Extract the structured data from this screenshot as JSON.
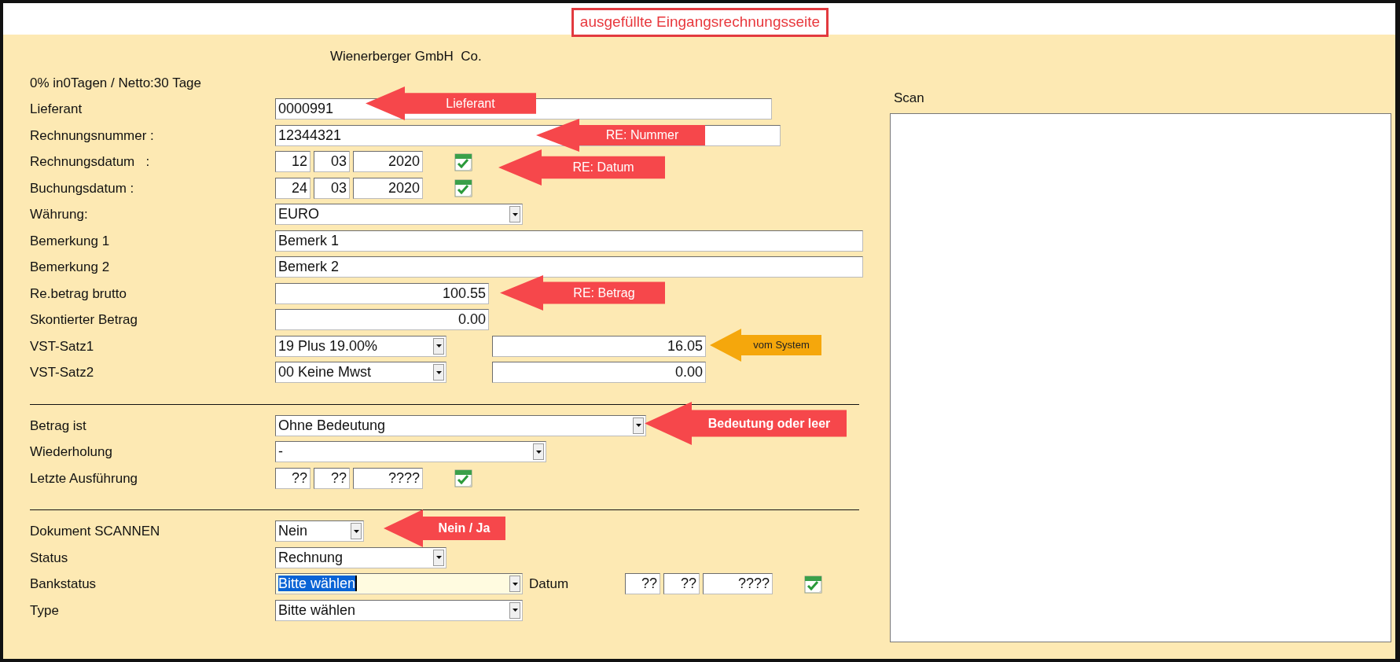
{
  "page_title": "ausgefüllte Eingangsrechnungsseite",
  "company": "Wienerberger GmbH  Co.",
  "payment_terms": "0% in0Tagen / Netto:30 Tage",
  "form": {
    "rows": [
      {
        "kind": "field",
        "label": "Lieferant",
        "controls": [
          {
            "kind": "text",
            "value": "0000991"
          }
        ]
      },
      {
        "kind": "field",
        "label": "Rechnungsnummer :",
        "controls": [
          {
            "kind": "text",
            "value": "12344321"
          }
        ]
      },
      {
        "kind": "field",
        "label": "Rechnungsdatum   :",
        "controls": [
          {
            "kind": "date",
            "day": "12",
            "month": "03",
            "year": "2020",
            "calendar": true
          }
        ]
      },
      {
        "kind": "field",
        "label": "Buchungsdatum :",
        "controls": [
          {
            "kind": "date",
            "day": "24",
            "month": "03",
            "year": "2020",
            "calendar": true
          }
        ]
      },
      {
        "kind": "field",
        "label": "Währung:",
        "controls": [
          {
            "kind": "select",
            "value": "EURO"
          }
        ]
      },
      {
        "kind": "field",
        "label": "Bemerkung 1",
        "controls": [
          {
            "kind": "text",
            "value": "Bemerk 1"
          }
        ]
      },
      {
        "kind": "field",
        "label": "Bemerkung 2",
        "controls": [
          {
            "kind": "text",
            "value": "Bemerk 2"
          }
        ]
      },
      {
        "kind": "field",
        "label": "Re.betrag brutto",
        "controls": [
          {
            "kind": "number",
            "value": "100.55"
          }
        ]
      },
      {
        "kind": "field",
        "label": "Skontierter Betrag",
        "controls": [
          {
            "kind": "number",
            "value": "0.00"
          }
        ]
      },
      {
        "kind": "field",
        "label": "VST-Satz1",
        "controls": [
          {
            "kind": "select",
            "value": "19 Plus 19.00%"
          },
          {
            "kind": "number",
            "value": "16.05"
          }
        ]
      },
      {
        "kind": "field",
        "label": "VST-Satz2",
        "controls": [
          {
            "kind": "select",
            "value": "00 Keine Mwst"
          },
          {
            "kind": "number",
            "value": "0.00"
          }
        ]
      },
      {
        "kind": "divider"
      },
      {
        "kind": "field",
        "label": "Betrag ist",
        "controls": [
          {
            "kind": "select",
            "value": "Ohne Bedeutung"
          }
        ]
      },
      {
        "kind": "field",
        "label": "Wiederholung",
        "controls": [
          {
            "kind": "select",
            "value": "-"
          }
        ]
      },
      {
        "kind": "field",
        "label": "Letzte Ausführung",
        "controls": [
          {
            "kind": "date",
            "day": "??",
            "month": "??",
            "year": "????",
            "calendar": true
          }
        ]
      },
      {
        "kind": "divider"
      },
      {
        "kind": "field",
        "label": "Dokument SCANNEN",
        "controls": [
          {
            "kind": "select",
            "value": "Nein"
          }
        ]
      },
      {
        "kind": "field",
        "label": "Status",
        "controls": [
          {
            "kind": "select",
            "value": "Rechnung"
          }
        ]
      },
      {
        "kind": "field",
        "label": "Bankstatus",
        "controls": [
          {
            "kind": "select",
            "value": "Bitte wählen",
            "focused": true
          },
          {
            "kind": "label",
            "text": "Datum"
          },
          {
            "kind": "date",
            "day": "??",
            "month": "??",
            "year": "????",
            "calendar": true
          }
        ]
      },
      {
        "kind": "field",
        "label": "Type",
        "controls": [
          {
            "kind": "select",
            "value": "Bitte wählen"
          }
        ]
      }
    ]
  },
  "scan": {
    "label": "Scan"
  },
  "annotations": [
    {
      "text": "Lieferant",
      "color": "#f6474b"
    },
    {
      "text": "RE: Nummer",
      "color": "#f6474b"
    },
    {
      "text": "RE: Datum",
      "color": "#f6474b"
    },
    {
      "text": "RE: Betrag",
      "color": "#f6474b"
    },
    {
      "text": "vom System",
      "color": "#f5a70c"
    },
    {
      "text": "Bedeutung oder leer",
      "color": "#f6474b"
    },
    {
      "text": "Nein / Ja",
      "color": "#f6474b"
    }
  ]
}
